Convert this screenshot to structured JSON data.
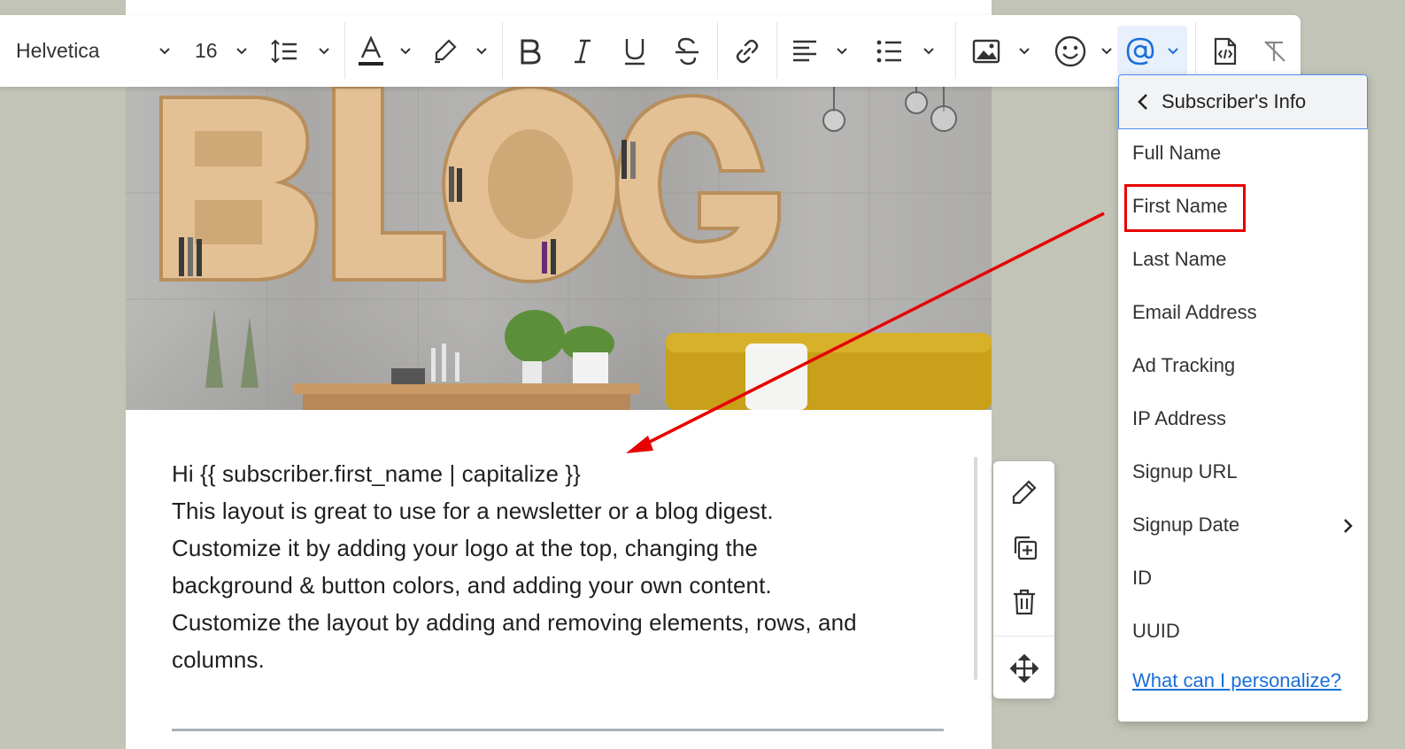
{
  "toolbar": {
    "font_family": "Helvetica",
    "font_size": "16",
    "icons": [
      "line-height-icon",
      "text-color-icon",
      "highlight-icon",
      "bold-icon",
      "italic-icon",
      "underline-icon",
      "strikethrough-icon",
      "link-icon",
      "align-icon",
      "list-icon",
      "image-icon",
      "emoji-icon",
      "mention-icon",
      "source-code-icon",
      "clear-format-icon"
    ]
  },
  "hero": {
    "word": "BLOG"
  },
  "body": {
    "lines": [
      "Hi {{ subscriber.first_name | capitalize }}",
      "This layout is great to use for a newsletter or a blog digest.",
      "Customize it by adding your logo at the top, changing the",
      "background & button colors, and adding your own content.",
      "Customize the layout by adding and removing elements, rows, and",
      "columns."
    ]
  },
  "dropdown": {
    "header": "Subscriber's Info",
    "items": [
      "Full Name",
      "First Name",
      "Last Name",
      "Email Address",
      "Ad Tracking",
      "IP Address",
      "Signup URL",
      "Signup Date",
      "ID",
      "UUID"
    ],
    "highlighted": "First Name",
    "help_link": "What can I personalize?"
  },
  "side_actions": [
    "edit-icon",
    "duplicate-icon",
    "delete-icon",
    "move-icon"
  ],
  "colors": {
    "accent": "#1a6fd8",
    "highlight": "#e60000",
    "active_bg": "#e8f0fc",
    "page_bg": "#c1c4b6"
  }
}
